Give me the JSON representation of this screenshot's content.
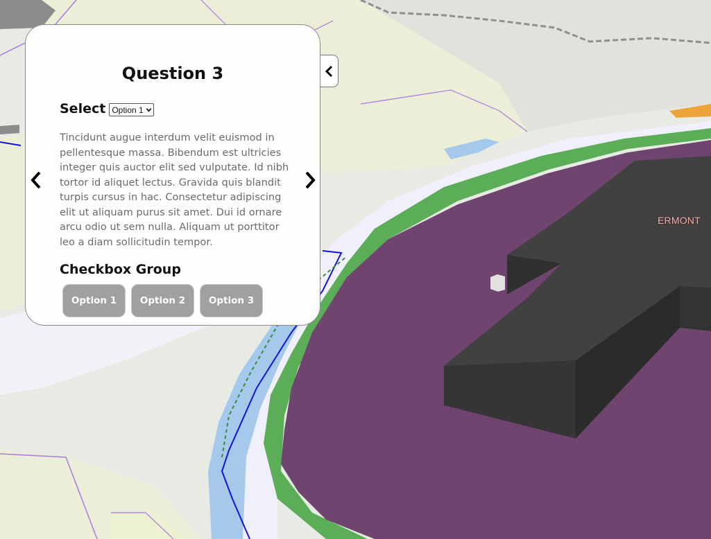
{
  "map": {
    "place_label": "ERMONT",
    "colors": {
      "land": "#e8ebe4",
      "farmland": "#eceed8",
      "water": "#a4c9ea",
      "river_pale": "#eff0fb",
      "residential_zone": "#6f4570",
      "park_strip": "#5bae57",
      "building_3d": "#3f3f3f",
      "boundary_line": "#1010d8",
      "admin_line": "#a77ae0"
    }
  },
  "panel": {
    "title": "Question 3",
    "select_label": "Select",
    "select_value": "Option 1",
    "body_text": "Tincidunt augue interdum velit euismod in pellentesque massa. Bibendum est ultricies integer quis auctor elit sed vulputate. Id nibh tortor id aliquet lectus. Gravida quis blandit turpis cursus in hac. Consectetur adipiscing elit ut aliquam purus sit amet. Dui id ornare arcu odio ut sem nulla. Aliquam ut porttitor leo a diam sollicitudin tempor.",
    "checkbox_group_label": "Checkbox Group",
    "checkbox_options": [
      "Option 1",
      "Option 2",
      "Option 3"
    ],
    "prev_icon": "chevron-left-icon",
    "next_icon": "chevron-right-icon",
    "collapse_icon": "chevron-left-icon"
  }
}
